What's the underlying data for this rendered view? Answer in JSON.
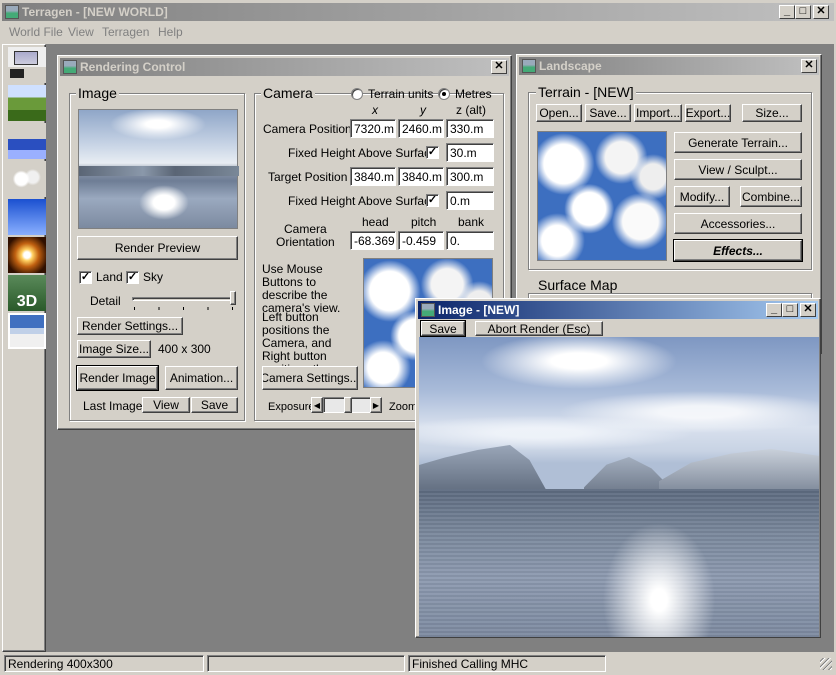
{
  "app": {
    "title": "Terragen  -  [NEW WORLD]",
    "menu": [
      "World File",
      "View",
      "Terragen",
      "Help"
    ]
  },
  "toolbar_icons": [
    "rendering-control-icon",
    "landscape-icon",
    "water-icon",
    "clouds-icon",
    "sky-icon",
    "lighting-icon",
    "3d-preview-icon",
    "image-icon"
  ],
  "rendering_control": {
    "title": "Rendering Control",
    "image_group": "Image",
    "render_preview": "Render Preview",
    "land": "Land",
    "sky": "Sky",
    "land_checked": true,
    "sky_checked": true,
    "detail": "Detail",
    "detail_level": 1.0,
    "render_settings": "Render Settings...",
    "image_size": "Image Size...",
    "image_size_value": "400 x 300",
    "render_image": "Render Image",
    "animation": "Animation...",
    "last_image": "Last Image:",
    "view": "View",
    "save": "Save",
    "camera_group": "Camera",
    "terrain_units": "Terrain units",
    "metres": "Metres",
    "units_selected": "Metres",
    "col_x": "x",
    "col_y": "y",
    "col_z": "z (alt)",
    "camera_position": "Camera Position",
    "cam_x": "7320.m",
    "cam_y": "2460.m",
    "cam_z": "330.m",
    "fixed_height_1": "Fixed Height Above Surface",
    "fixed_height_1_checked": true,
    "fixed_height_1_value": "30.m",
    "target_position": "Target Position",
    "tgt_x": "3840.m",
    "tgt_y": "3840.m",
    "tgt_z": "300.m",
    "fixed_height_2": "Fixed Height Above Surface",
    "fixed_height_2_checked": true,
    "fixed_height_2_value": "0.m",
    "camera_orientation": "Camera\nOrientation",
    "col_head": "head",
    "col_pitch": "pitch",
    "col_bank": "bank",
    "head": "-68.369",
    "pitch": "-0.459",
    "bank": "0.",
    "mouse_help_1": "Use Mouse Buttons to describe the camera's view.",
    "mouse_help_2": "Left button positions the Camera, and Right button positions the Target.",
    "camera_settings": "Camera Settings...",
    "exposure": "Exposure",
    "zoom": "Zoom"
  },
  "landscape": {
    "title": "Landscape",
    "terrain_group": "Terrain - [NEW]",
    "open": "Open...",
    "save": "Save...",
    "import": "Import...",
    "export": "Export...",
    "size": "Size...",
    "generate_terrain": "Generate Terrain...",
    "view_sculpt": "View / Sculpt...",
    "modify": "Modify...",
    "combine": "Combine...",
    "accessories": "Accessories...",
    "effects": "Effects...",
    "surface_map": "Surface Map"
  },
  "image_window": {
    "title": "Image - [NEW]",
    "save": "Save",
    "abort_render": "Abort Render (Esc)"
  },
  "status_bar": {
    "left": "Rendering 400x300",
    "middle": "",
    "right": "Finished Calling MHC"
  }
}
